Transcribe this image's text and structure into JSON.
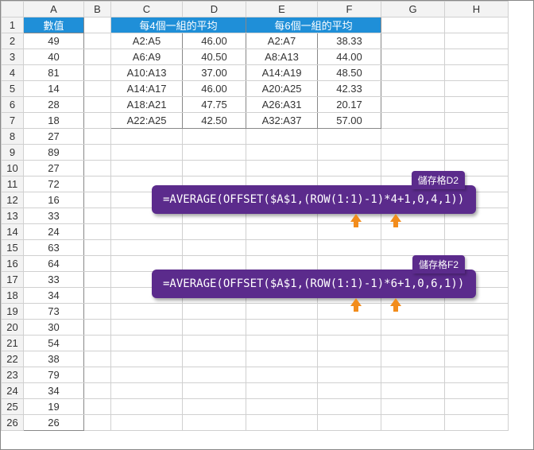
{
  "columns": [
    "A",
    "B",
    "C",
    "D",
    "E",
    "F",
    "G",
    "H"
  ],
  "rows_shown": 26,
  "headers": {
    "A1": "數值",
    "CD1": "每4個一組的平均",
    "EF1": "每6個一組的平均"
  },
  "values_A": [
    49,
    40,
    81,
    14,
    28,
    18,
    27,
    89,
    27,
    72,
    16,
    33,
    24,
    63,
    64,
    33,
    34,
    73,
    30,
    54,
    38,
    79,
    34,
    19,
    26
  ],
  "group4": {
    "ranges": [
      "A2:A5",
      "A6:A9",
      "A10:A13",
      "A14:A17",
      "A18:A21",
      "A22:A25"
    ],
    "avgs": [
      "46.00",
      "40.50",
      "37.00",
      "46.00",
      "47.75",
      "42.50"
    ]
  },
  "group6": {
    "ranges": [
      "A2:A7",
      "A8:A13",
      "A14:A19",
      "A20:A25",
      "A26:A31",
      "A32:A37"
    ],
    "avgs": [
      "38.33",
      "44.00",
      "48.50",
      "42.33",
      "20.17",
      "57.00"
    ]
  },
  "callout1": {
    "tag": "儲存格D2",
    "formula": "=AVERAGE(OFFSET($A$1,(ROW(1:1)-1)*4+1,0,4,1))"
  },
  "callout2": {
    "tag": "儲存格F2",
    "formula": "=AVERAGE(OFFSET($A$1,(ROW(1:1)-1)*6+1,0,6,1))"
  },
  "chart_data": {
    "type": "table",
    "title": "",
    "columns": [
      "數值",
      "每4個一組的平均 range",
      "每4個一組的平均 value",
      "每6個一組的平均 range",
      "每6個一組的平均 value"
    ],
    "data_A": [
      49,
      40,
      81,
      14,
      28,
      18,
      27,
      89,
      27,
      72,
      16,
      33,
      24,
      63,
      64,
      33,
      34,
      73,
      30,
      54,
      38,
      79,
      34,
      19,
      26
    ],
    "group4": [
      [
        "A2:A5",
        46.0
      ],
      [
        "A6:A9",
        40.5
      ],
      [
        "A10:A13",
        37.0
      ],
      [
        "A14:A17",
        46.0
      ],
      [
        "A18:A21",
        47.75
      ],
      [
        "A22:A25",
        42.5
      ]
    ],
    "group6": [
      [
        "A2:A7",
        38.33
      ],
      [
        "A8:A13",
        44.0
      ],
      [
        "A14:A19",
        48.5
      ],
      [
        "A20:A25",
        42.33
      ],
      [
        "A26:A31",
        20.17
      ],
      [
        "A32:A37",
        57.0
      ]
    ]
  }
}
